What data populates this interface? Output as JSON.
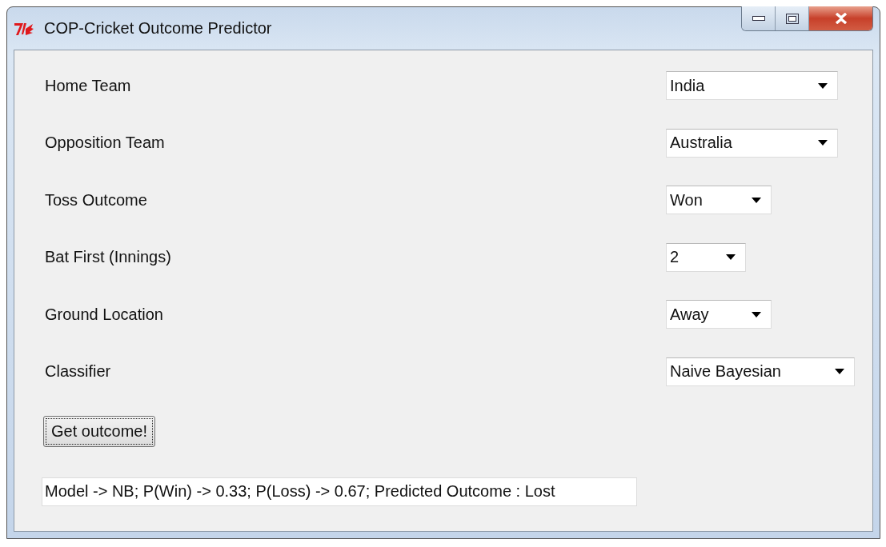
{
  "window": {
    "title": "COP-Cricket Outcome Predictor"
  },
  "fields": [
    {
      "label": "Home Team",
      "value": "India"
    },
    {
      "label": "Opposition Team",
      "value": "Australia"
    },
    {
      "label": "Toss Outcome",
      "value": "Won"
    },
    {
      "label": "Bat First (Innings)",
      "value": "2"
    },
    {
      "label": "Ground Location",
      "value": "Away"
    },
    {
      "label": "Classifier",
      "value": "Naive Bayesian"
    }
  ],
  "button": {
    "label": "Get outcome!",
    "focused": true
  },
  "result": "Model -> NB; P(Win) -> 0.33; P(Loss) -> 0.67; Predicted Outcome : Lost"
}
